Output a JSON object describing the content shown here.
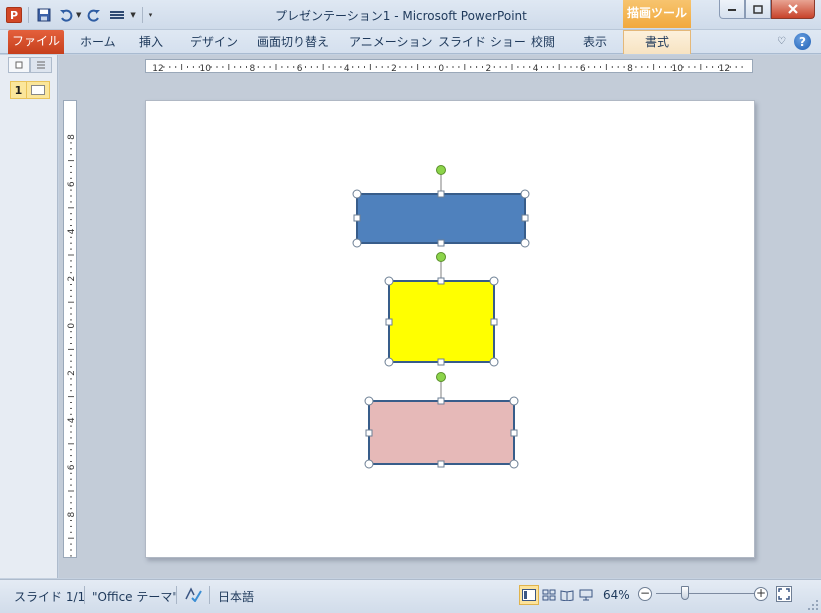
{
  "window": {
    "title": "プレゼンテーション1  -  Microsoft PowerPoint",
    "context_group": "描画ツール"
  },
  "qat": {
    "app_icon": "powerpoint-logo-icon",
    "app_letter": "P",
    "buttons": [
      "save-icon",
      "undo-icon",
      "redo-icon",
      "customize-icon"
    ]
  },
  "ribbon": {
    "file_tab": "ファイル",
    "tabs": [
      "ホーム",
      "挿入",
      "デザイン",
      "画面切り替え",
      "アニメーション",
      "スライド ショー",
      "校閲",
      "表示"
    ],
    "context_tab": "書式"
  },
  "slide_pane": {
    "thumbnail_number": "1"
  },
  "rulers": {
    "horizontal_labels": [
      "12",
      "10",
      "8",
      "6",
      "4",
      "2",
      "0",
      "2",
      "4",
      "6",
      "8",
      "10",
      "12"
    ],
    "vertical_labels": [
      "8",
      "6",
      "4",
      "2",
      "0",
      "2",
      "4",
      "6",
      "8"
    ]
  },
  "shapes": [
    {
      "name": "blue-rectangle",
      "fill": "#4f81bd",
      "stroke": "#385d8a"
    },
    {
      "name": "yellow-rectangle",
      "fill": "#ffff00",
      "stroke": "#385d8a"
    },
    {
      "name": "pink-rectangle",
      "fill": "#e6b9b8",
      "stroke": "#385d8a"
    }
  ],
  "colors": {
    "selection_handle": "#ffffff",
    "rotation_handle": "#8cd44a",
    "file_tab": "#d24726",
    "context_tab": "#f1a93e"
  },
  "status": {
    "slide": "スライド 1/1",
    "theme": "\"Office テーマ\"",
    "language": "日本語",
    "zoom": "64%"
  }
}
